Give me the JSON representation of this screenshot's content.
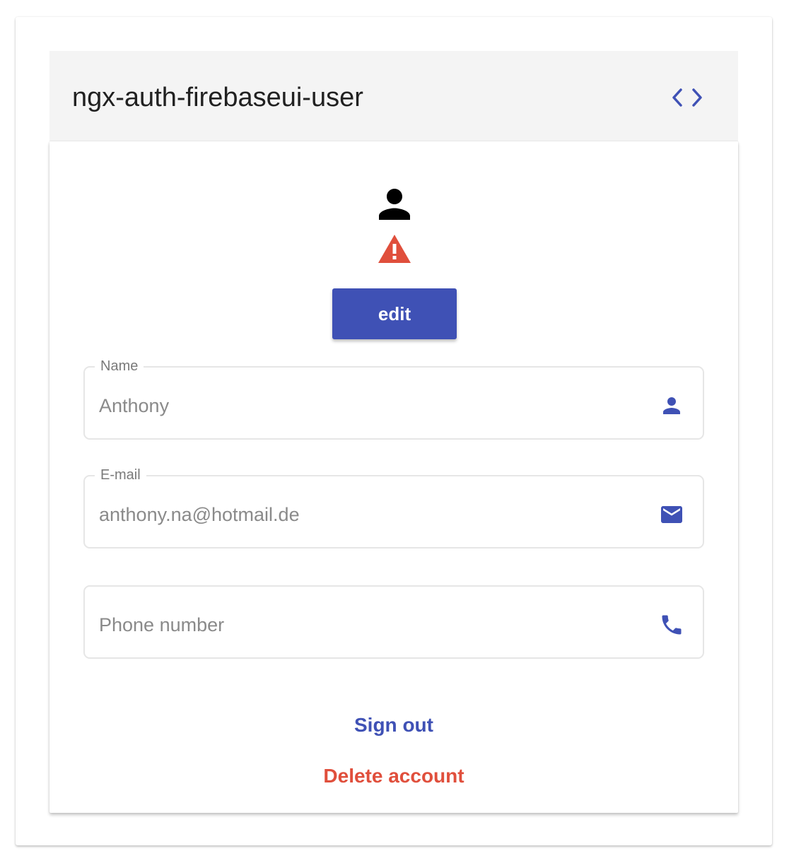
{
  "header": {
    "title": "ngx-auth-firebaseui-user",
    "code_icon": "code-icon"
  },
  "user": {
    "avatar_icon": "person-icon",
    "warning_icon": "warning-icon",
    "edit_label": "edit"
  },
  "fields": {
    "name": {
      "label": "Name",
      "value": "Anthony",
      "icon": "person-icon"
    },
    "email": {
      "label": "E-mail",
      "value": "anthony.na@hotmail.de",
      "icon": "mail-icon"
    },
    "phone": {
      "placeholder": "Phone number",
      "value": "",
      "icon": "phone-icon"
    }
  },
  "actions": {
    "sign_out": "Sign out",
    "delete_account": "Delete account"
  },
  "colors": {
    "primary": "#3f51b5",
    "warn": "#e04f3c",
    "header_bg": "#f4f4f4"
  }
}
